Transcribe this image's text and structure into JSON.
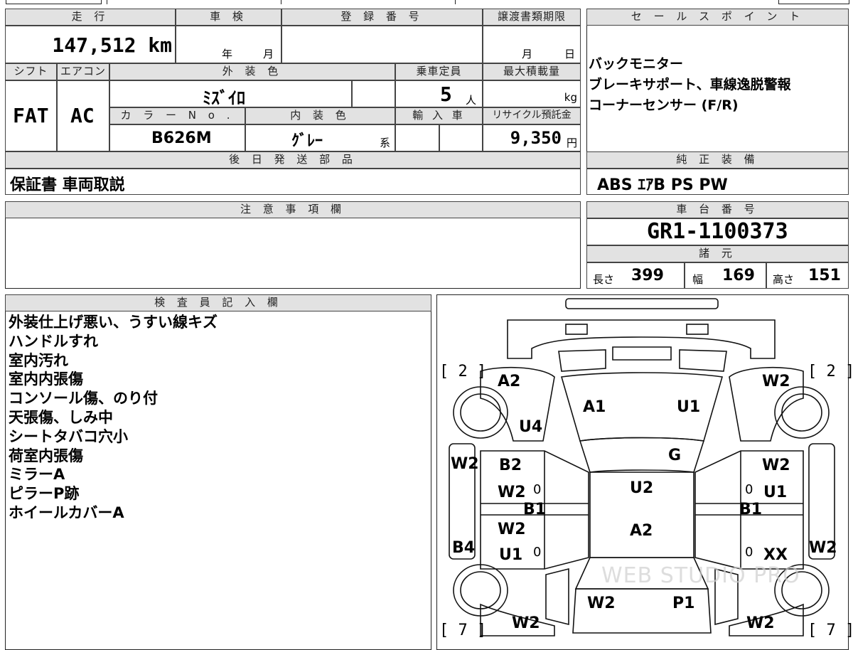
{
  "headers": {
    "mileage": "走 行",
    "shaken": "車 検",
    "registration": "登 録 番 号",
    "transfer_deadline": "譲渡書類期限",
    "sales_points": "セ ー ル ス ポ イ ン ト",
    "shift": "シフト",
    "aircon": "エアコン",
    "exterior_color": "外 装 色",
    "capacity": "乗車定員",
    "max_load": "最大積載量",
    "color_no": "カ ラ ー N o .",
    "interior_color": "内 装 色",
    "import": "輸 入 車",
    "recycle": "リサイクル預託金",
    "later_parts": "後 日 発 送 部 品",
    "oem_equipment": "純 正 装 備",
    "notes": "注 意 事 項 欄",
    "chassis": "車 台 番 号",
    "specs": "諸 元",
    "inspector": "検 査 員 記 入 欄"
  },
  "vehicle": {
    "mileage": "147,512 km",
    "shaken_year_unit": "年",
    "shaken_month_unit": "月",
    "deadline_month_unit": "月",
    "deadline_day_unit": "日",
    "shift": "FAT",
    "aircon": "AC",
    "exterior_color": "ﾐｽﾞｲﾛ",
    "capacity": "5",
    "capacity_unit": "人",
    "load_unit": "kg",
    "color_no": "B626M",
    "interior_color": "ｸﾞﾚｰ",
    "interior_suffix": "系",
    "recycle_fee": "9,350",
    "recycle_unit": "円",
    "later_parts": "保証書 車両取説",
    "oem_equipment": "ABS ｴｱB PS PW",
    "chassis_no": "GR1-1100373",
    "length_label": "長さ",
    "length": "399",
    "width_label": "幅",
    "width": "169",
    "height_label": "高さ",
    "height": "151"
  },
  "sales_points": [
    "バックモニター",
    "ブレーキサポート、車線逸脱警報",
    "コーナーセンサー (F/R)"
  ],
  "inspector_remarks": [
    "外装仕上げ悪い、うすい線キズ",
    "ハンドルすれ",
    "室内汚れ",
    "室内内張傷",
    "コンソール傷、のり付",
    "天張傷、しみ中",
    "シートタバコ穴小",
    "荷室内張傷",
    "ミラーA",
    "ピラーP跡",
    "ホイールカバーA"
  ],
  "damage_map": {
    "left_front_tire": "[ 2 ]",
    "right_front_tire": "[ 2 ]",
    "left_rear_tire": "[ 7 ]",
    "right_rear_tire": "[ 7 ]",
    "front_left_fender": "A2",
    "hood_left": "A1",
    "hood_right": "U1",
    "front_right_fender": "W2",
    "front_left_fender_lower": "U4",
    "windshield": "G",
    "left_pillar": "W2",
    "left_front_door": "B2",
    "left_front_door_2": "W2",
    "left_rocker": "B1",
    "left_rear_door": "W2",
    "left_rear_door_2": "U1",
    "left_rear_quarter": "B4",
    "roof_front": "U2",
    "roof_rear": "A2",
    "right_front_door": "W2",
    "right_front_door_2": "U1",
    "right_rocker": "B1",
    "right_rear_door": "XX",
    "right_side_rear": "W2",
    "rear_glass_left": "W2",
    "rear_glass_right": "P1",
    "rear_left": "W2",
    "rear_right": "W2",
    "zero_mark": "0"
  },
  "watermark": "WEB STUDIO PRO"
}
